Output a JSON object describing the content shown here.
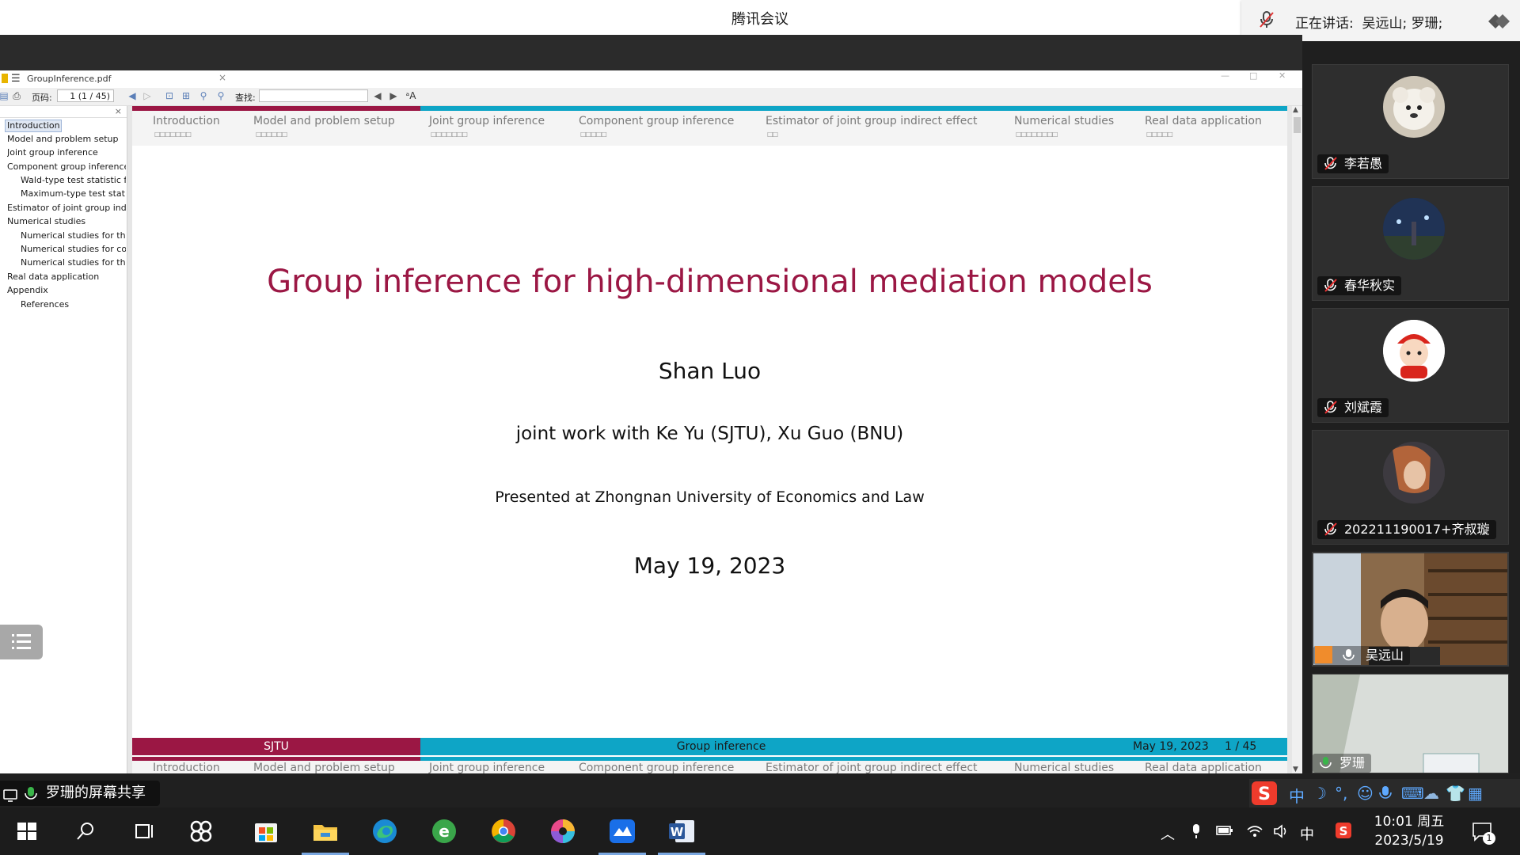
{
  "app": {
    "title": "腾讯会议"
  },
  "speaking": {
    "label": "正在讲话:",
    "names": "吴远山; 罗珊;"
  },
  "viewer": {
    "filename": "GroupInference.pdf",
    "page_label": "页码:",
    "page_value": "1 (1 / 45)",
    "find_label": "查找:"
  },
  "outline": {
    "items": [
      {
        "label": "Introduction"
      },
      {
        "label": "Model and problem setup"
      },
      {
        "label": "Joint group inference"
      },
      {
        "label": "Component group inference"
      },
      {
        "label": "Wald-type test statistic for"
      },
      {
        "label": "Maximum-type test statist"
      },
      {
        "label": "Estimator of joint group indir"
      },
      {
        "label": "Numerical studies"
      },
      {
        "label": "Numerical studies for the"
      },
      {
        "label": "Numerical studies for com"
      },
      {
        "label": "Numerical studies for the"
      },
      {
        "label": "Real data application"
      },
      {
        "label": "Appendix"
      },
      {
        "label": "References"
      }
    ]
  },
  "slide": {
    "nav_sections": [
      {
        "label": "Introduction"
      },
      {
        "label": "Model and problem setup"
      },
      {
        "label": "Joint group inference"
      },
      {
        "label": "Component group inference"
      },
      {
        "label": "Estimator of joint group indirect effect"
      },
      {
        "label": "Numerical studies"
      },
      {
        "label": "Real data application"
      }
    ],
    "title": "Group inference for high-dimensional mediation models",
    "author": "Shan Luo",
    "joint": "joint work with Ke Yu (SJTU), Xu Guo (BNU)",
    "presented": "Presented at Zhongnan University of Economics and Law",
    "date": "May 19, 2023",
    "footer": {
      "institute": "SJTU",
      "short_title": "Group inference",
      "date": "May 19, 2023",
      "page": "1 / 45"
    },
    "colors": {
      "primary": "#9b1744",
      "secondary": "#0ea5c6"
    }
  },
  "participants": [
    {
      "name": "李若愚",
      "mic": "muted"
    },
    {
      "name": "春华秋实",
      "mic": "muted"
    },
    {
      "name": "刘斌霞",
      "mic": "muted"
    },
    {
      "name": "202211190017+齐叔璇",
      "mic": "muted"
    },
    {
      "name": "吴远山",
      "mic": "on"
    },
    {
      "name": "罗珊",
      "mic": "on"
    }
  ],
  "share": {
    "label": "罗珊的屏幕共享"
  },
  "taskbar": {
    "ime_mode": "中",
    "tray_lang": "中",
    "time": "10:01 周五",
    "date": "2023/5/19",
    "notifications": "1"
  }
}
